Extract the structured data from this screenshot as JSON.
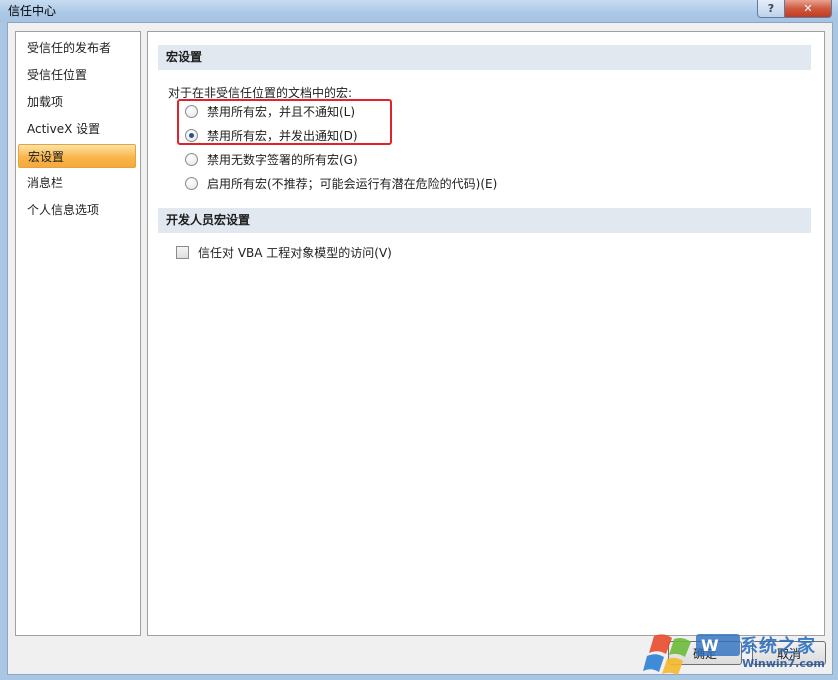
{
  "window": {
    "title": "信任中心",
    "help_label": "?",
    "close_label": "✕"
  },
  "sidebar": {
    "items": [
      {
        "label": "受信任的发布者"
      },
      {
        "label": "受信任位置"
      },
      {
        "label": "加载项"
      },
      {
        "label": "ActiveX 设置"
      },
      {
        "label": "宏设置",
        "selected": true
      },
      {
        "label": "消息栏"
      },
      {
        "label": "个人信息选项"
      }
    ]
  },
  "macro": {
    "header": "宏设置",
    "intro": "对于在非受信任位置的文档中的宏:",
    "options": [
      {
        "label": "禁用所有宏，并且不通知(L)",
        "checked": false
      },
      {
        "label": "禁用所有宏，并发出通知(D)",
        "checked": true
      },
      {
        "label": "禁用无数字签署的所有宏(G)",
        "checked": false
      },
      {
        "label": "启用所有宏(不推荐；可能会运行有潜在危险的代码)(E)",
        "checked": false
      }
    ]
  },
  "developer": {
    "header": "开发人员宏设置",
    "vba_label": "信任对 VBA 工程对象模型的访问(V)",
    "vba_checked": false
  },
  "buttons": {
    "ok": "确定",
    "cancel": "取消"
  },
  "watermark": {
    "brand": "系统之家",
    "url": "Winwin7.com"
  },
  "colors": {
    "highlight_box": "#e0232b",
    "selected_item": "#f9b64d",
    "section_header_bg": "#e1e8f0"
  }
}
